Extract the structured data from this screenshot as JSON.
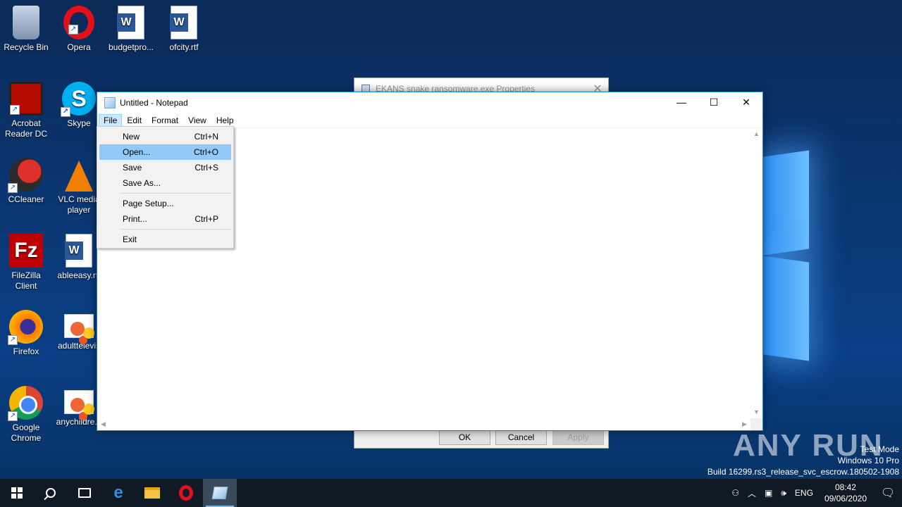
{
  "desktop": {
    "icons": [
      {
        "label": "Recycle Bin",
        "icon": "recycle-bin-icon"
      },
      {
        "label": "Opera",
        "icon": "opera-icon"
      },
      {
        "label": "budgetpro...",
        "icon": "word-doc-icon"
      },
      {
        "label": "ofcity.rtf",
        "icon": "word-doc-icon"
      },
      {
        "label": "Acrobat Reader DC",
        "icon": "acrobat-icon"
      },
      {
        "label": "Skype",
        "icon": "skype-icon"
      },
      {
        "label": "CCleaner",
        "icon": "ccleaner-icon"
      },
      {
        "label": "VLC media player",
        "icon": "vlc-icon"
      },
      {
        "label": "FileZilla Client",
        "icon": "filezilla-icon"
      },
      {
        "label": "ableeasy.rtf",
        "icon": "word-doc-icon"
      },
      {
        "label": "Firefox",
        "icon": "firefox-icon"
      },
      {
        "label": "adulttelevis",
        "icon": "image-icon"
      },
      {
        "label": "Google Chrome",
        "icon": "chrome-icon"
      },
      {
        "label": "anychildre...",
        "icon": "image-icon"
      }
    ]
  },
  "properties_window": {
    "title": "EKANS snake ransomware.exe Properties",
    "close_glyph": "✕",
    "buttons": {
      "ok": "OK",
      "cancel": "Cancel",
      "apply": "Apply"
    }
  },
  "notepad": {
    "title": "Untitled - Notepad",
    "controls": {
      "minimize": "—",
      "maximize": "☐",
      "close": "✕"
    },
    "menu": [
      "File",
      "Edit",
      "Format",
      "View",
      "Help"
    ],
    "active_menu": "File",
    "file_menu": [
      {
        "label": "New",
        "shortcut": "Ctrl+N"
      },
      {
        "label": "Open...",
        "shortcut": "Ctrl+O",
        "highlighted": true
      },
      {
        "label": "Save",
        "shortcut": "Ctrl+S"
      },
      {
        "label": "Save As...",
        "shortcut": ""
      },
      {
        "label": "Page Setup...",
        "shortcut": ""
      },
      {
        "label": "Print...",
        "shortcut": "Ctrl+P"
      },
      {
        "label": "Exit",
        "shortcut": ""
      }
    ]
  },
  "watermark": {
    "brand": "ANY RUN",
    "line1": "Test Mode",
    "line2": "Windows 10 Pro",
    "line3": "Build 16299.rs3_release_svc_escrow.180502-1908"
  },
  "taskbar": {
    "tray": {
      "language": "ENG",
      "time": "08:42",
      "date": "09/06/2020"
    }
  },
  "colors": {
    "menu_highlight": "#91c9f7",
    "window_border": "#1883d7",
    "taskbar": "#101a24"
  }
}
